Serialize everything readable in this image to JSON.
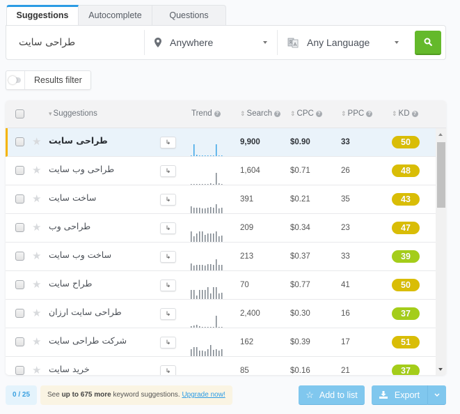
{
  "tabs": [
    {
      "label": "Suggestions",
      "active": true
    },
    {
      "label": "Autocomplete",
      "active": false
    },
    {
      "label": "Questions",
      "active": false
    }
  ],
  "search": {
    "keyword_value": "طراحی سایت",
    "location": {
      "icon": "map-marker-icon",
      "value": "Anywhere"
    },
    "language": {
      "icon": "translate-icon",
      "value": "Any Language"
    },
    "submit_icon": "search-icon",
    "submit_color": "#64b92b"
  },
  "filter": {
    "label": "Results filter",
    "enabled": false
  },
  "table": {
    "columns": {
      "suggestions": "Suggestions",
      "trend": "Trend",
      "search": "Search",
      "cpc": "CPC",
      "ppc": "PPC",
      "kd": "KD"
    },
    "rows": [
      {
        "keyword": "طراحی سایت",
        "search": "9,900",
        "cpc": "$0.90",
        "ppc": "33",
        "kd": "50",
        "kd_color": "#d9bd06",
        "active": true,
        "trend": [
          0.08,
          1,
          0.1,
          0.05,
          0.05,
          0.05,
          0.05,
          0.05,
          0.05,
          1,
          0.08,
          0.08
        ]
      },
      {
        "keyword": "طراحی وب سایت",
        "search": "1,604",
        "cpc": "$0.71",
        "ppc": "26",
        "kd": "48",
        "kd_color": "#d9bd06",
        "trend": [
          0.05,
          0.05,
          0.05,
          0.05,
          0.05,
          0.05,
          0.05,
          0.1,
          0.05,
          1,
          0.1,
          0.05
        ]
      },
      {
        "keyword": "ساخت سایت",
        "search": "391",
        "cpc": "$0.21",
        "ppc": "35",
        "kd": "43",
        "kd_color": "#d9bd06",
        "trend": [
          0.6,
          0.45,
          0.45,
          0.45,
          0.4,
          0.4,
          0.45,
          0.5,
          0.45,
          0.75,
          0.4,
          0.45
        ]
      },
      {
        "keyword": "طراحی وب",
        "search": "209",
        "cpc": "$0.34",
        "ppc": "23",
        "kd": "47",
        "kd_color": "#d9bd06",
        "trend": [
          0.9,
          0.45,
          0.7,
          0.9,
          0.9,
          0.6,
          0.7,
          0.7,
          0.7,
          0.9,
          0.45,
          0.5
        ]
      },
      {
        "keyword": "ساخت وب سایت",
        "search": "213",
        "cpc": "$0.37",
        "ppc": "33",
        "kd": "39",
        "kd_color": "#a4cd1a",
        "trend": [
          0.6,
          0.4,
          0.45,
          0.45,
          0.45,
          0.4,
          0.55,
          0.55,
          0.45,
          0.95,
          0.45,
          0.45
        ]
      },
      {
        "keyword": "طراح سایت",
        "search": "70",
        "cpc": "$0.77",
        "ppc": "41",
        "kd": "50",
        "kd_color": "#d9bd06",
        "trend": [
          0.75,
          0.75,
          0.3,
          0.75,
          0.75,
          0.75,
          1,
          0.45,
          1,
          1,
          0.45,
          0.5
        ]
      },
      {
        "keyword": "طراحی سایت ارزان",
        "search": "2,400",
        "cpc": "$0.30",
        "ppc": "16",
        "kd": "37",
        "kd_color": "#a4cd1a",
        "trend": [
          0.1,
          0.2,
          0.25,
          0.1,
          0.05,
          0.05,
          0.05,
          0.05,
          0.05,
          1,
          0.05,
          0.05
        ]
      },
      {
        "keyword": "شرکت طراحی سایت",
        "search": "162",
        "cpc": "$0.39",
        "ppc": "17",
        "kd": "51",
        "kd_color": "#d9bd06",
        "trend": [
          0.6,
          0.75,
          0.75,
          0.45,
          0.45,
          0.4,
          0.6,
          0.95,
          0.5,
          0.6,
          0.45,
          0.6
        ]
      },
      {
        "keyword": "خرید سایت",
        "search": "85",
        "cpc": "$0.16",
        "ppc": "21",
        "kd": "37",
        "kd_color": "#a4cd1a",
        "trend": [
          0,
          0,
          0,
          0,
          0,
          0,
          0,
          0,
          0,
          0,
          0,
          0.1
        ]
      }
    ]
  },
  "footer": {
    "counter": "0 / 25",
    "notice_prefix": "See ",
    "notice_bold": "up to 675 more",
    "notice_suffix": " keyword suggestions. ",
    "notice_link": "Upgrade now!",
    "add_to_list": "Add to list",
    "export": "Export"
  }
}
